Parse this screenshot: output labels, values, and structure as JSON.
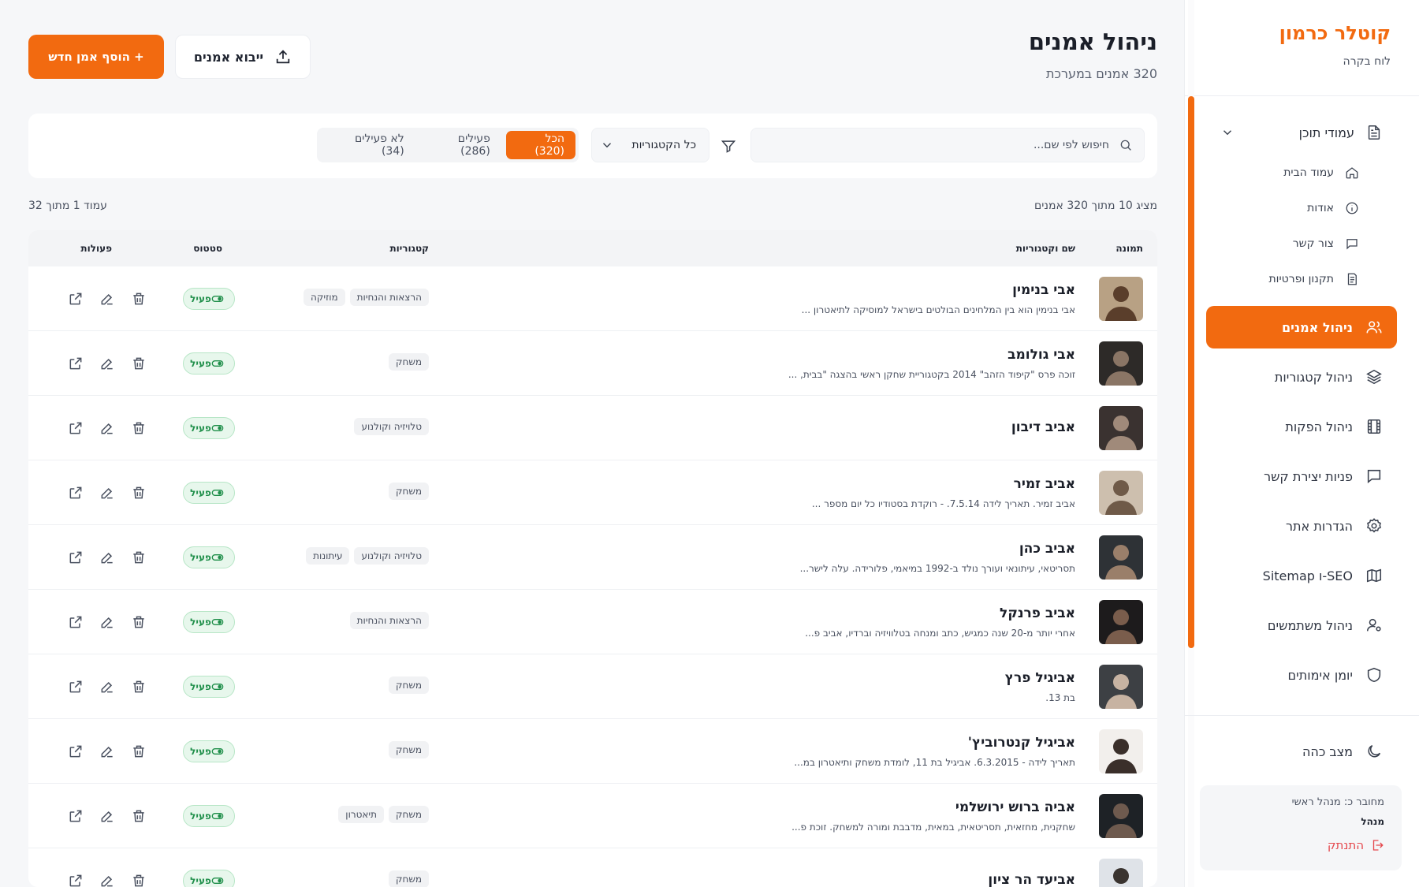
{
  "sidebar": {
    "brand": "קוטלר כרמון",
    "brand_sub": "לוח בקרה",
    "content_pages": "עמודי תוכן",
    "sub_items": [
      {
        "label": "עמוד הבית",
        "icon": "home-icon"
      },
      {
        "label": "אודות",
        "icon": "info-icon"
      },
      {
        "label": "צור קשר",
        "icon": "message-icon"
      },
      {
        "label": "תקנון ופרטיות",
        "icon": "document-icon"
      }
    ],
    "items": [
      {
        "label": "ניהול אמנים",
        "icon": "users-icon",
        "active": true
      },
      {
        "label": "ניהול קטגוריות",
        "icon": "layers-icon"
      },
      {
        "label": "ניהול הפקות",
        "icon": "film-icon"
      },
      {
        "label": "פניות יצירת קשר",
        "icon": "chat-icon"
      },
      {
        "label": "הגדרות אתר",
        "icon": "gear-icon"
      },
      {
        "label": "SEO-ו Sitemap",
        "icon": "map-icon"
      },
      {
        "label": "ניהול משתמשים",
        "icon": "user-gear-icon"
      },
      {
        "label": "יומן אימותים",
        "icon": "shield-icon"
      }
    ],
    "dark_mode": "מצב כהה",
    "user_line": "מחובר כ: מנהל ראשי",
    "user_role": "מנהל",
    "logout": "התנתק"
  },
  "header": {
    "title": "ניהול אמנים",
    "subtitle": "320 אמנים במערכת",
    "add_button": "+ הוסף אמן חדש",
    "import_button": "ייבוא אמנים"
  },
  "filters": {
    "search_placeholder": "חיפוש לפי שם...",
    "category_select": "כל הקטגוריות",
    "tabs": [
      {
        "label": "הכל (320)",
        "active": true
      },
      {
        "label": "פעילים (286)",
        "active": false
      },
      {
        "label": "לא פעילים (34)",
        "active": false
      }
    ]
  },
  "meta": {
    "showing": "מציג 10 מתוך 320 אמנים",
    "page": "עמוד 1 מתוך 32"
  },
  "table": {
    "headers": {
      "image": "תמונה",
      "name": "שם וקטגוריות",
      "categories": "קטגוריות",
      "status": "סטטוס",
      "actions": "פעולות"
    },
    "rows": [
      {
        "name": "אבי בנימין",
        "desc": "אבי בנימין הוא בין המלחינים הבולטים בישראל למוסיקה לתיאטרון ...",
        "categories": [
          "הרצאות והנחיות",
          "מוזיקה"
        ],
        "status": "פעיל"
      },
      {
        "name": "אבי גולומב",
        "desc": "זוכה פרס \"קיפוד הזהב\" 2014 בקטגוריית שחקן ראשי בהצגה \"בבית, ...",
        "categories": [
          "משחק"
        ],
        "status": "פעיל"
      },
      {
        "name": "אביב דיבון",
        "desc": "",
        "categories": [
          "טלויזיה וקולנוע"
        ],
        "status": "פעיל"
      },
      {
        "name": "אביב זמיר",
        "desc": "אביב זמיר. תאריך לידה 7.5.14. - רוקדת בסטודיו כל יום מספר ...",
        "categories": [
          "משחק"
        ],
        "status": "פעיל"
      },
      {
        "name": "אביב כהן",
        "desc": "תסריטאי, עיתונאי ועורך נולד ב-1992 במיאמי, פלורידה. עלה לישר...",
        "categories": [
          "טלויזיה וקולנוע",
          "עיתונות"
        ],
        "status": "פעיל"
      },
      {
        "name": "אביב פרנקל",
        "desc": "אחרי יותר מ-20 שנה כמגיש, כתב ומנחה בטלוויזיה וברדיו, אביב פ...",
        "categories": [
          "הרצאות והנחיות"
        ],
        "status": "פעיל"
      },
      {
        "name": "אביגיל פרץ",
        "desc": "בת 13.",
        "categories": [
          "משחק"
        ],
        "status": "פעיל"
      },
      {
        "name": "אביגיל קנטרוביץ'",
        "desc": "תאריך לידה - 6.3.2015. אביגיל בת 11, לומדת משחק ותיאטרון במ...",
        "categories": [
          "משחק"
        ],
        "status": "פעיל"
      },
      {
        "name": "אביה ברוש ירושלמי",
        "desc": "שחקנית, מחזאית, תסריטאית, במאית, מדבבת ומורה למשחק. זוכת פ...",
        "categories": [
          "משחק",
          "תיאטרון"
        ],
        "status": "פעיל"
      },
      {
        "name": "אביעד הר ציון",
        "desc": "",
        "categories": [
          "משחק"
        ],
        "status": "פעיל"
      }
    ]
  },
  "colors": {
    "accent": "#f26a10",
    "status_green": "#1f8f4a",
    "background": "#f6f7f9"
  }
}
